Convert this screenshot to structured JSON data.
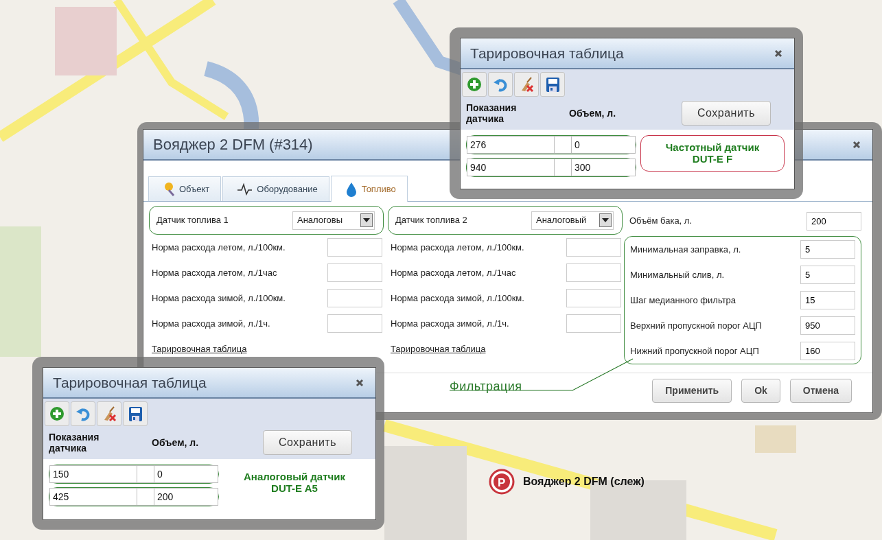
{
  "map": {
    "marker": {
      "letter": "P",
      "label": "Вояджер 2 DFM (слеж)"
    }
  },
  "main_dialog": {
    "title": "Вояджер 2 DFM (#314)",
    "tabs": [
      {
        "label": "Объект",
        "selected": false
      },
      {
        "label": "Оборудование",
        "selected": false
      },
      {
        "label": "Топливо",
        "selected": true
      }
    ],
    "sensors": [
      {
        "label": "Датчик топлива 1",
        "type": "Аналоговы",
        "rates": [
          "Норма расхода летом, л./100км.",
          "Норма расхода летом, л./1час",
          "Норма расхода зимой, л./100км.",
          "Норма расхода зимой, л./1ч."
        ],
        "link": "Тарировочная таблица"
      },
      {
        "label": "Датчик топлива 2",
        "type": "Аналоговый",
        "rates": [
          "Норма расхода летом, л./100км.",
          "Норма расхода летом, л./1час",
          "Норма расхода зимой, л./100км.",
          "Норма расхода зимой, л./1ч."
        ],
        "link": "Тарировочная таблица"
      }
    ],
    "tank": {
      "label": "Объём бака, л.",
      "value": "200"
    },
    "filtration": {
      "caption": "Фильтрация",
      "fields": [
        {
          "label": "Минимальная заправка, л.",
          "value": "5"
        },
        {
          "label": "Минимальный слив, л.",
          "value": "5"
        },
        {
          "label": "Шаг медианного фильтра",
          "value": "15"
        },
        {
          "label": "Верхний пропускной порог АЦП",
          "value": "950"
        },
        {
          "label": "Нижний пропускной порог АЦП",
          "value": "160"
        }
      ]
    },
    "buttons": [
      "Применить",
      "Ok",
      "Отмена"
    ]
  },
  "calibration_dialogs": [
    {
      "title": "Тарировочная таблица",
      "columns": [
        "Показания датчика",
        "Объем, л."
      ],
      "save_button": "Сохранить",
      "rows": [
        [
          "276",
          "0"
        ],
        [
          "940",
          "300"
        ]
      ],
      "note": "Частотный датчик\nDUT-E F",
      "note_highlighted": true
    },
    {
      "title": "Тарировочная таблица",
      "columns": [
        "Показания датчика",
        "Объем, л."
      ],
      "save_button": "Сохранить",
      "rows": [
        [
          "150",
          "0"
        ],
        [
          "425",
          "200"
        ]
      ],
      "note": "Аналоговый датчик\nDUT-E A5",
      "note_highlighted": false
    }
  ]
}
